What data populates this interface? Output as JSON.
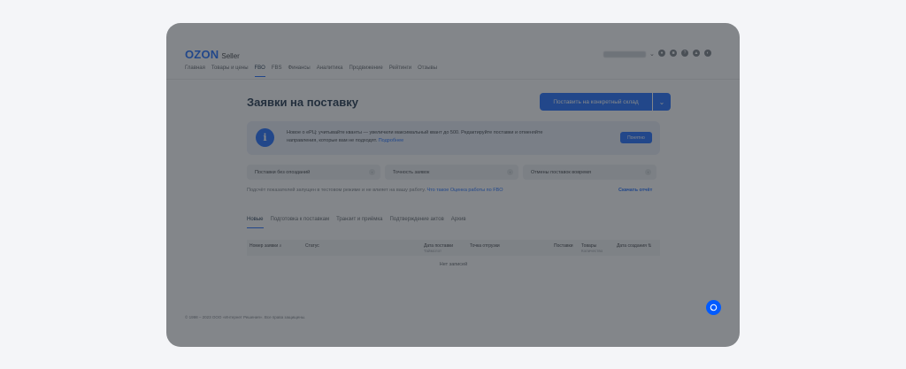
{
  "header": {
    "logo": "OZON",
    "logo_sub": "Seller",
    "nav": [
      "Главная",
      "Товары и цены",
      "FBO",
      "FBS",
      "Финансы",
      "Аналитика",
      "Продвижение",
      "Рейтинги",
      "Отзывы"
    ],
    "active_nav": "FBO"
  },
  "page": {
    "title": "Заявки на поставку",
    "primary_button": "Поставить на конкретный склад"
  },
  "banner": {
    "text": "Новое о eРЦ: учитывайте кванты — увеличили максимальный квант до 500. Редактируйте поставки и отменяйте направления, которые вам не подходят.",
    "link": "Подробнее",
    "button": "Понятно"
  },
  "filters": [
    "Поставки без опозданий",
    "Точность заявок",
    "Отмены поставок вовремя"
  ],
  "note": {
    "text": "Подсчёт показателей запущен в тестовом режиме и не влияет на вашу работу.",
    "link": "Что такое Оценка работы по FBO"
  },
  "download_label": "Скачать отчёт",
  "tabs": [
    "Новые",
    "Подготовка к поставкам",
    "Транзит и приёмка",
    "Подтверждение актов",
    "Архив"
  ],
  "active_tab": "Новые",
  "table": {
    "columns": [
      {
        "label": "Номер заявки",
        "sub": ""
      },
      {
        "label": "Статус",
        "sub": ""
      },
      {
        "label": "Дата поставки",
        "sub": "Таймслот"
      },
      {
        "label": "Точка отгрузки",
        "sub": ""
      },
      {
        "label": "Поставки",
        "sub": ""
      },
      {
        "label": "Товары",
        "sub": "Количество"
      },
      {
        "label": "Дата создания",
        "sub": ""
      }
    ],
    "empty": "Нет записей"
  },
  "footer": "© 1998 – 2023 ООО «Интернет Решения». Все права защищены.",
  "colors": {
    "accent": "#005bff",
    "overlay": "#373c42"
  }
}
